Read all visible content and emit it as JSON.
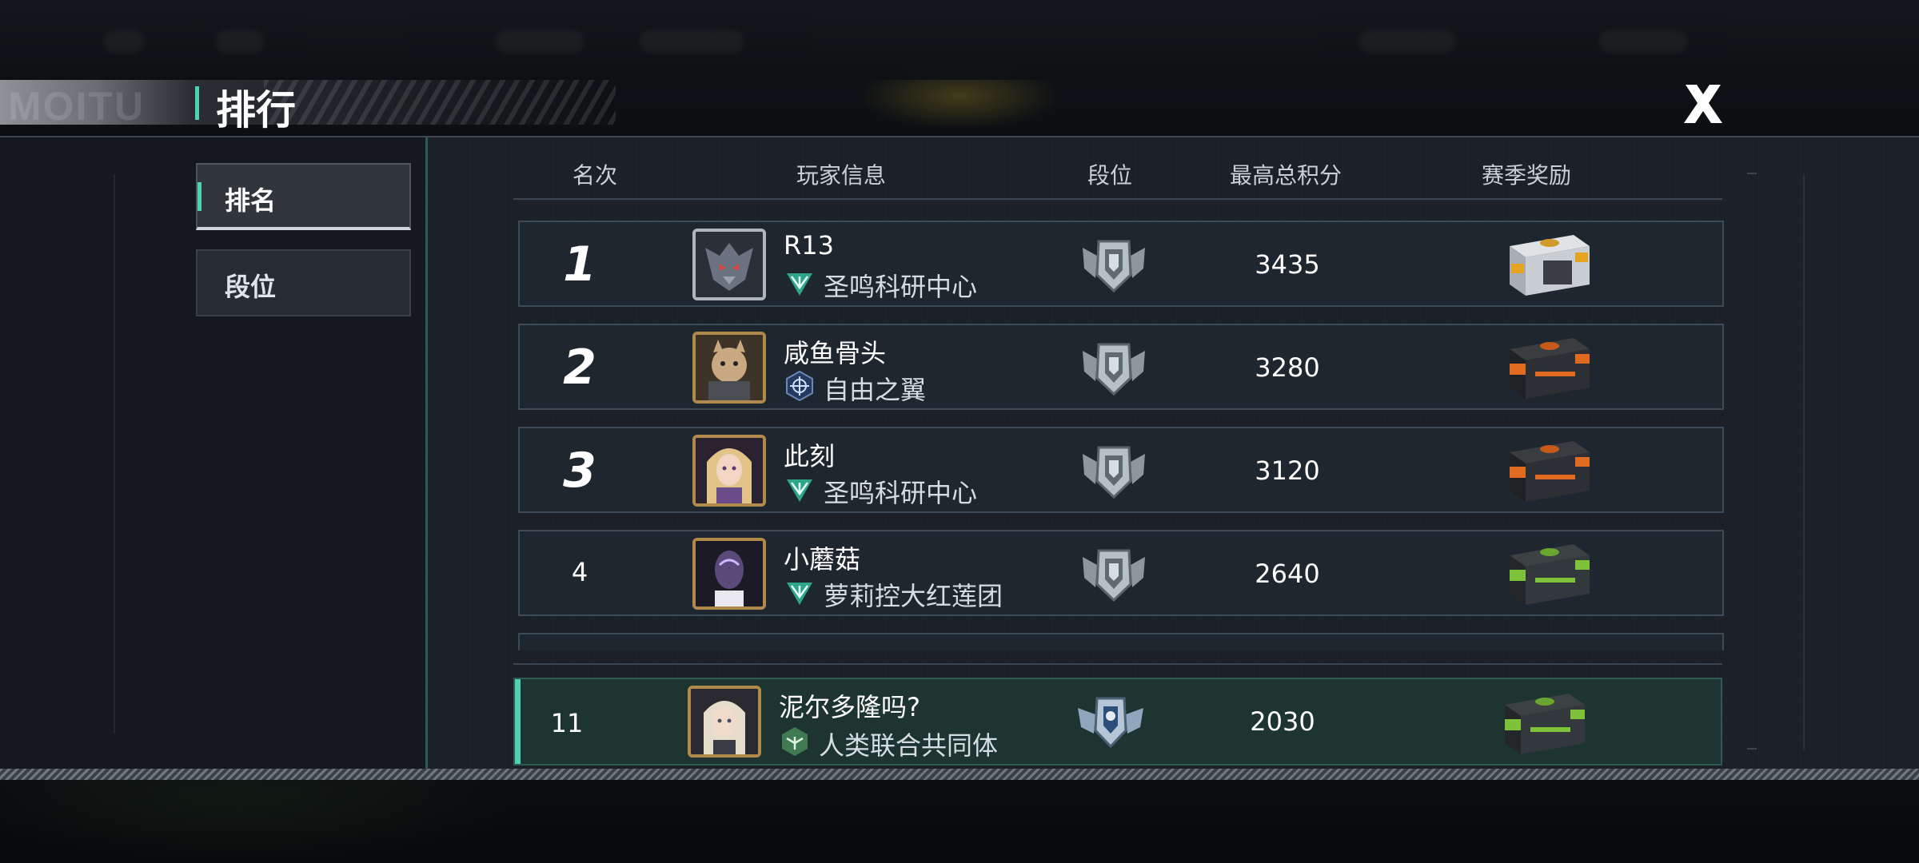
{
  "page": {
    "title": "排行",
    "header_ghost_text": "MOITU"
  },
  "tabs": [
    {
      "label": "排名",
      "active": true
    },
    {
      "label": "段位",
      "active": false
    }
  ],
  "table": {
    "headers": [
      "名次",
      "玩家信息",
      "段位",
      "最高总积分",
      "赛季奖励"
    ]
  },
  "rows": [
    {
      "rank": "1",
      "name": "R13",
      "guild": "圣鸣科研中心",
      "guild_icon": "winged-emblem-icon",
      "score": "3435",
      "reward": "silver-gold-crate"
    },
    {
      "rank": "2",
      "name": "咸鱼骨头",
      "guild": "自由之翼",
      "guild_icon": "compass-shield-icon",
      "score": "3280",
      "reward": "orange-black-crate"
    },
    {
      "rank": "3",
      "name": "此刻",
      "guild": "圣鸣科研中心",
      "guild_icon": "winged-emblem-icon",
      "score": "3120",
      "reward": "orange-black-crate"
    },
    {
      "rank": "4",
      "name": "小蘑菇",
      "guild": "萝莉控大红莲团",
      "guild_icon": "winged-emblem-icon",
      "score": "2640",
      "reward": "green-black-crate"
    }
  ],
  "self": {
    "rank": "11",
    "name": "泥尔多隆吗?",
    "guild": "人类联合共同体",
    "guild_icon": "eagle-hex-icon",
    "score": "2030",
    "reward": "green-black-crate"
  },
  "colors": {
    "accent": "#4fd1b0",
    "row_bg": "#1e2630",
    "self_row_bg": "#1e3430"
  }
}
